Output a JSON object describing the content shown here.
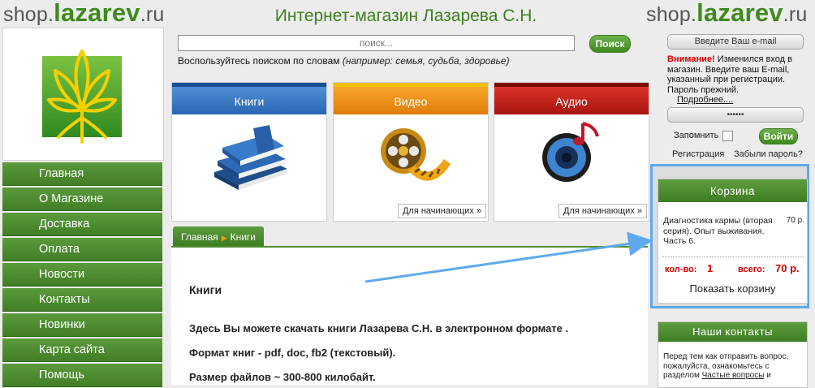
{
  "header": {
    "left_logo": {
      "prefix": "shop.",
      "brand": "lazarev",
      "suffix": ".ru"
    },
    "right_logo": {
      "prefix": "shop.",
      "brand": "lazarev",
      "suffix": ".ru"
    },
    "site_title": "Интернет-магазин Лазарева С.Н."
  },
  "colors": {
    "accent_green": "#3f8a1e",
    "nav_green": "#4e8f2f",
    "alert_red": "#d10000",
    "highlight_blue": "#5ea9ee"
  },
  "nav": {
    "items": [
      {
        "label": "Главная"
      },
      {
        "label": "О Магазине"
      },
      {
        "label": "Доставка"
      },
      {
        "label": "Оплата"
      },
      {
        "label": "Новости"
      },
      {
        "label": "Контакты"
      },
      {
        "label": "Новинки"
      },
      {
        "label": "Карта сайта"
      },
      {
        "label": "Помощь"
      }
    ]
  },
  "search": {
    "placeholder": "поиск...",
    "button_label": "Поиск",
    "hint_prefix": "Воспользуйтесь поиском по словам",
    "hint_examples": "(например: семья, судьба, здоровье)"
  },
  "categories": [
    {
      "label": "Книги",
      "icon": "books-icon"
    },
    {
      "label": "Видео",
      "icon": "film-reel-icon",
      "beginners_link": "Для начинающих »"
    },
    {
      "label": "Аудио",
      "icon": "speaker-icon",
      "beginners_link": "Для начинающих »"
    }
  ],
  "breadcrumb": {
    "home": "Главная",
    "current": "Книги"
  },
  "content": {
    "title": "Книги",
    "lines": [
      "Здесь Вы можете скачать книги Лазарева С.Н. в электронном формате .",
      "Формат книг - pdf, doc, fb2 (текстовый).",
      "Размер файлов ~ 300-800 килобайт."
    ]
  },
  "login": {
    "email_placeholder": "Введите Ваш e-mail",
    "notice_warning": "Внимание!",
    "notice_text": "Изменился вход в магазин. Введите ваш E-mail, указанный при регистрации. Пароль прежний.",
    "notice_more": "Подробнее....",
    "password_mask": "••••••",
    "remember_label": "Запомнить",
    "login_button": "Войти",
    "register_link": "Регистрация",
    "forgot_link": "Забыли пароль?"
  },
  "cart": {
    "title": "Корзина",
    "item_name": "Диагностика кармы (вторая серия). Опыт выживания. Часть 6.",
    "item_price": "70 р.",
    "qty_label": "кол-во:",
    "qty_value": "1",
    "total_label": "всего:",
    "total_value": "70 р.",
    "show_cart": "Показать корзину"
  },
  "contacts": {
    "title": "Наши контакты",
    "text_before": "Перед тем как отправить вопрос, пожалуйста, ознакомьтесь с разделом",
    "faq_link": "Частые вопросы",
    "text_after": "и"
  }
}
